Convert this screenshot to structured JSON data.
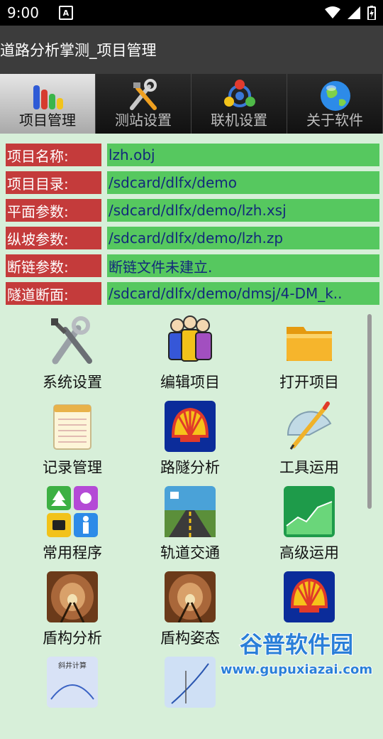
{
  "status": {
    "time": "9:00",
    "notif_glyph": "A"
  },
  "app": {
    "title": "道路分析掌测_项目管理"
  },
  "tabs": [
    {
      "label": "项目管理",
      "icon": "bar-chart-icon",
      "active": true
    },
    {
      "label": "测站设置",
      "icon": "tools-icon",
      "active": false
    },
    {
      "label": "联机设置",
      "icon": "network-icon",
      "active": false
    },
    {
      "label": "关于软件",
      "icon": "globe-icon",
      "active": false
    }
  ],
  "info": [
    {
      "label": "项目名称:",
      "value": "lzh.obj"
    },
    {
      "label": "项目目录:",
      "value": "/sdcard/dlfx/demo"
    },
    {
      "label": "平面参数:",
      "value": "/sdcard/dlfx/demo/lzh.xsj"
    },
    {
      "label": "纵坡参数:",
      "value": "/sdcard/dlfx/demo/lzh.zp"
    },
    {
      "label": "断链参数:",
      "value": "断链文件未建立."
    },
    {
      "label": "隧道断面:",
      "value": "/sdcard/dlfx/demo/dmsj/4-DM_k.."
    }
  ],
  "grid": [
    {
      "label": "系统设置",
      "icon": "settings-tools-icon"
    },
    {
      "label": "编辑项目",
      "icon": "people-icon"
    },
    {
      "label": "打开项目",
      "icon": "folder-icon"
    },
    {
      "label": "记录管理",
      "icon": "notepad-icon"
    },
    {
      "label": "路隧分析",
      "icon": "shell-logo-icon"
    },
    {
      "label": "工具运用",
      "icon": "protractor-icon"
    },
    {
      "label": "常用程序",
      "icon": "apps-icon"
    },
    {
      "label": "轨道交通",
      "icon": "road-icon"
    },
    {
      "label": "高级运用",
      "icon": "area-chart-icon"
    },
    {
      "label": "盾构分析",
      "icon": "tunnel-icon"
    },
    {
      "label": "盾构姿态",
      "icon": "tunnel-icon"
    },
    {
      "label": "",
      "icon": "shell-logo-icon"
    },
    {
      "label": "",
      "icon": "shaft-calc-icon",
      "caption": "斜井计算"
    },
    {
      "label": "",
      "icon": "curve-icon"
    },
    {
      "label": "",
      "icon": "blank-icon"
    }
  ],
  "watermark": {
    "text_cn": "谷普软件园",
    "text_url": "www.gupuxiazai.com"
  }
}
